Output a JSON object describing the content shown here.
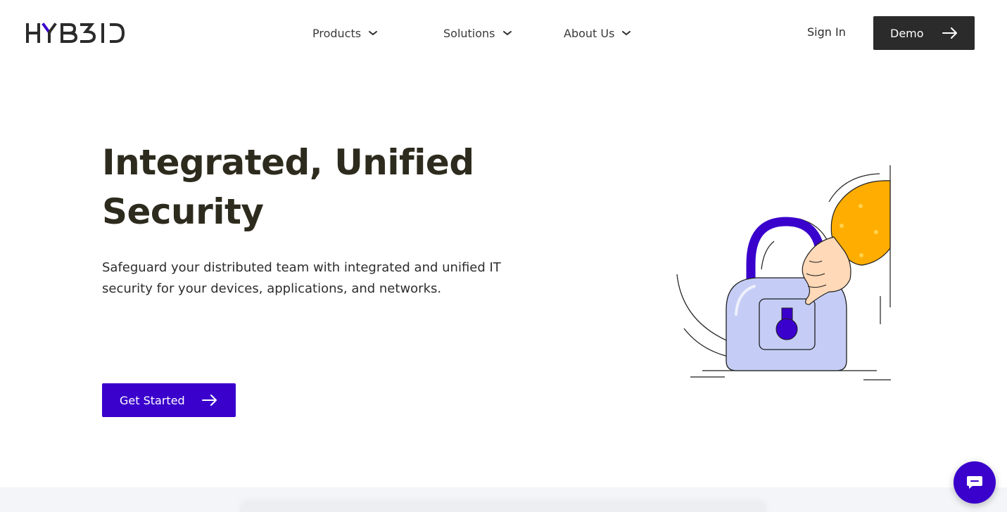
{
  "colors": {
    "brand": "#3a00cc",
    "dark": "#2b2b2b",
    "heading": "#2d2b1d",
    "lock_body": "#c5cdf6",
    "sleeve": "#ffad00",
    "hand": "#ffd9b8"
  },
  "nav": {
    "logo_text": "HYBRID",
    "items": [
      {
        "label": "Products",
        "icon": "chevron-down-icon"
      },
      {
        "label": "Solutions",
        "icon": "chevron-down-icon"
      },
      {
        "label": "About Us",
        "icon": "chevron-down-icon"
      }
    ],
    "signin_label": "Sign In",
    "demo_label": "Demo",
    "demo_icon": "arrow-right-icon"
  },
  "hero": {
    "title": "Integrated, Unified Security",
    "subtitle": "Safeguard your distributed team with integrated and unified IT security for your devices, applications, and networks.",
    "cta_label": "Get Started",
    "cta_icon": "arrow-right-icon",
    "illustration": "padlock-hand-illustration"
  },
  "chat": {
    "icon": "chat-icon"
  }
}
